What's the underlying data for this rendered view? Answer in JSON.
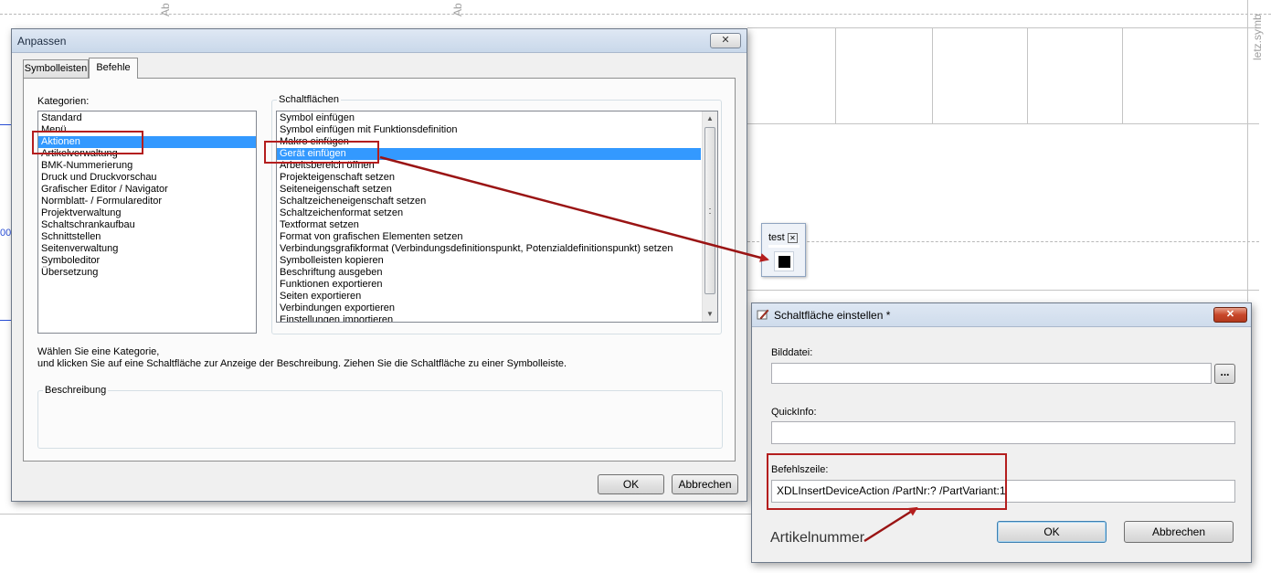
{
  "background": {
    "sheet_labels": [
      "Ab",
      "Ab",
      "letz.symb"
    ],
    "edge_label": "00"
  },
  "customize_dialog": {
    "title": "Anpassen",
    "close_glyph": "✕",
    "tabs": [
      "Symbolleisten",
      "Befehle"
    ],
    "active_tab": "Befehle",
    "categories_label": "Kategorien:",
    "categories": [
      "Standard",
      "Menü",
      "Aktionen",
      "Artikelverwaltung",
      "BMK-Nummerierung",
      "Druck und Druckvorschau",
      "Grafischer Editor / Navigator",
      "Normblatt- / Formulareditor",
      "Projektverwaltung",
      "Schaltschrankaufbau",
      "Schnittstellen",
      "Seitenverwaltung",
      "Symboleditor",
      "Übersetzung"
    ],
    "selected_category": "Aktionen",
    "buttons_label": "Schaltflächen",
    "buttons": [
      "Symbol einfügen",
      "Symbol einfügen mit Funktionsdefinition",
      "Makro einfügen",
      "Gerät einfügen",
      "Arbeitsbereich öffnen",
      "Projekteigenschaft setzen",
      "Seiteneigenschaft setzen",
      "Schaltzeicheneigenschaft setzen",
      "Schaltzeichenformat setzen",
      "Textformat setzen",
      "Format von grafischen Elementen setzen",
      "Verbindungsgrafikformat (Verbindungsdefinitionspunkt, Potenzialdefinitionspunkt) setzen",
      "Symbolleisten kopieren",
      "Beschriftung ausgeben",
      "Funktionen exportieren",
      "Seiten exportieren",
      "Verbindungen exportieren",
      "Einstellungen importieren"
    ],
    "selected_button": "Gerät einfügen",
    "help_line1": "Wählen Sie eine Kategorie,",
    "help_line2": "und klicken Sie auf eine Schaltfläche zur Anzeige der Beschreibung. Ziehen Sie die Schaltfläche zu einer Symbolleiste.",
    "description_label": "Beschreibung",
    "description_text": "",
    "ok_label": "OK",
    "cancel_label": "Abbrechen"
  },
  "floating_toolbar": {
    "title": "test",
    "close_glyph": "✕",
    "button_color": "#000000"
  },
  "button_dialog": {
    "title": "Schaltfläche einstellen *",
    "close_glyph": "✕",
    "image_file_label": "Bilddatei:",
    "image_file_value": "",
    "browse_label": "...",
    "quickinfo_label": "QuickInfo:",
    "quickinfo_value": "",
    "command_label": "Befehlszeile:",
    "command_value": "XDLInsertDeviceAction /PartNr:? /PartVariant:1",
    "ok_label": "OK",
    "cancel_label": "Abbrechen"
  },
  "annotations": {
    "article_number_label": "Artikelnummer",
    "highlight_color": "#b41e1e"
  }
}
